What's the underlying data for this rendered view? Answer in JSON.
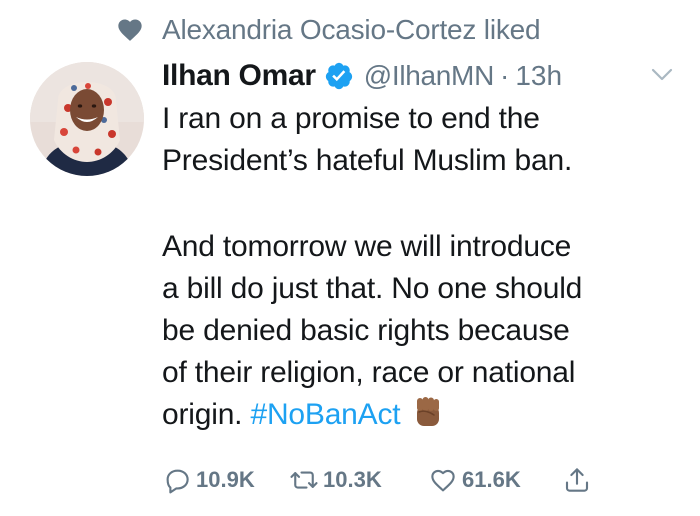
{
  "social_context": {
    "icon": "heart-icon",
    "text": "Alexandria Ocasio-Cortez liked"
  },
  "author": {
    "name": "Ilhan Omar",
    "handle": "@IlhanMN",
    "separator": "·",
    "time": "13h",
    "verified": true
  },
  "tweet": {
    "lines": [
      "I ran on a promise to end the",
      "President’s hateful Muslim ban.",
      "And tomorrow we will introduce",
      "a bill do just that. No one should",
      "be denied basic rights because",
      "of their religion, race or national"
    ],
    "last_line_prefix": "origin. ",
    "hashtag": "#NoBanAct",
    "emoji": "raised-fist-medium-dark-skin"
  },
  "actions": {
    "replies": "10.9K",
    "retweets": "10.3K",
    "likes": "61.6K"
  },
  "colors": {
    "accent": "#1da1f2",
    "secondary": "#657786",
    "text": "#14171a",
    "verified": "#1da1f2"
  }
}
